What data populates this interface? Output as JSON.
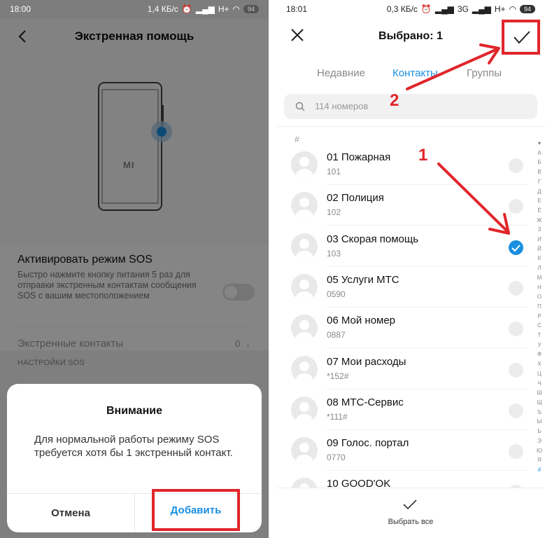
{
  "left": {
    "status": {
      "time": "18:00",
      "speed": "1,4 КБ/с",
      "network": "H+",
      "battery": "94"
    },
    "header": {
      "title": "Экстренная помощь"
    },
    "illustration": {
      "brand": "MI"
    },
    "sos": {
      "title": "Активировать режим SOS",
      "description": "Быстро нажмите кнопку питания 5 раз для отправки экстренным контактам сообщения SOS с вашим местоположением",
      "enabled": false
    },
    "emergency_contacts": {
      "label": "Экстренные контакты",
      "count": "0"
    },
    "section_label": "НАСТРОЙКИ SOS",
    "dialog": {
      "title": "Внимание",
      "message": "Для нормальной работы режиму SOS требуется хотя бы 1 экстренный контакт.",
      "cancel": "Отмена",
      "add": "Добавить"
    }
  },
  "right": {
    "status": {
      "time": "18:01",
      "speed": "0,3 КБ/с",
      "network": "3G",
      "network2": "H+",
      "battery": "94"
    },
    "header": {
      "title": "Выбрано: 1"
    },
    "tabs": [
      {
        "label": "Недавние",
        "active": false
      },
      {
        "label": "Контакты",
        "active": true
      },
      {
        "label": "Группы",
        "active": false
      }
    ],
    "search": {
      "placeholder": "114 номеров"
    },
    "section": "#",
    "contacts": [
      {
        "name": "01 Пожарная",
        "number": "101",
        "selected": false
      },
      {
        "name": "02 Полиция",
        "number": "102",
        "selected": false
      },
      {
        "name": "03 Скорая помощь",
        "number": "103",
        "selected": true
      },
      {
        "name": "05 Услуги МТС",
        "number": "0590",
        "selected": false
      },
      {
        "name": "06 Мой номер",
        "number": "0887",
        "selected": false
      },
      {
        "name": "07 Мои расходы",
        "number": "*152#",
        "selected": false
      },
      {
        "name": "08 МТС-Сервис",
        "number": "*111#",
        "selected": false
      },
      {
        "name": "09 Голос. портал",
        "number": "0770",
        "selected": false
      },
      {
        "name": "10 GOOD'OK",
        "number": "",
        "selected": false
      }
    ],
    "alphabet": [
      "♥",
      "А",
      "Б",
      "В",
      "Г",
      "Д",
      "Е",
      "Ё",
      "Ж",
      "З",
      "И",
      "Й",
      "К",
      "Л",
      "М",
      "Н",
      "О",
      "П",
      "Р",
      "С",
      "Т",
      "У",
      "Ф",
      "Х",
      "Ц",
      "Ч",
      "Ш",
      "Щ",
      "Ъ",
      "Ы",
      "Ь",
      "Э",
      "Ю",
      "Я",
      "#"
    ],
    "bottom": {
      "select_all": "Выбрать все"
    },
    "annotations": {
      "step1": "1",
      "step2": "2"
    }
  },
  "colors": {
    "accent": "#1a8fe0",
    "annotation_red": "#e0262b"
  }
}
